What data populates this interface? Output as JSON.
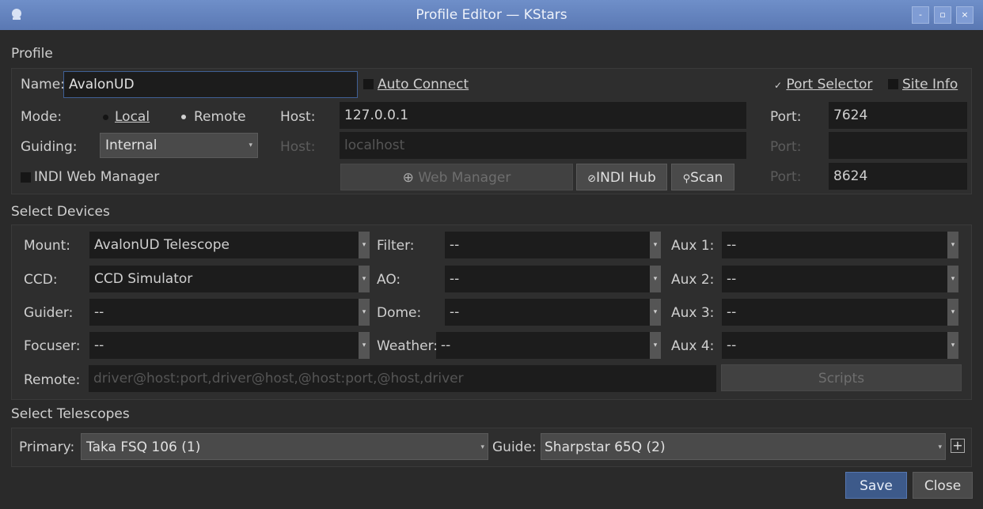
{
  "window": {
    "title": "Profile Editor — KStars",
    "controls": {
      "minimize": "-",
      "maximize": "▫",
      "close": "×"
    }
  },
  "profile": {
    "section_label": "Profile",
    "name_label": "Name:",
    "name_value": "AvalonUD",
    "auto_connect_label": "Auto Connect",
    "port_selector_label": "Port Selector",
    "port_selector_checked": true,
    "site_info_label": "Site Info",
    "mode_label": "Mode:",
    "mode_local": "Local",
    "mode_remote": "Remote",
    "mode_selected": "Remote",
    "host_label": "Host:",
    "host_value": "127.0.0.1",
    "port_label": "Port:",
    "port_value": "7624",
    "guiding_label": "Guiding:",
    "guiding_value": "Internal",
    "guide_host_label": "Host:",
    "guide_host_value": "localhost",
    "guide_port_label": "Port:",
    "guide_port_value": "",
    "indi_web_manager_label": "INDI Web Manager",
    "web_manager_button": "Web Manager",
    "indi_hub_button": "INDI Hub",
    "scan_button": "Scan",
    "web_port_label": "Port:",
    "web_port_value": "8624"
  },
  "devices": {
    "section_label": "Select Devices",
    "mount_label": "Mount:",
    "mount_value": "AvalonUD Telescope",
    "ccd_label": "CCD:",
    "ccd_value": "CCD Simulator",
    "guider_label": "Guider:",
    "guider_value": "--",
    "focuser_label": "Focuser:",
    "focuser_value": "--",
    "filter_label": "Filter:",
    "filter_value": "--",
    "ao_label": "AO:",
    "ao_value": "--",
    "dome_label": "Dome:",
    "dome_value": "--",
    "weather_label": "Weather:",
    "weather_value": "--",
    "aux1_label": "Aux 1:",
    "aux1_value": "--",
    "aux2_label": "Aux 2:",
    "aux2_value": "--",
    "aux3_label": "Aux 3:",
    "aux3_value": "--",
    "aux4_label": "Aux 4:",
    "aux4_value": "--",
    "remote_label": "Remote:",
    "remote_placeholder": "driver@host:port,driver@host,@host:port,@host,driver",
    "scripts_button": "Scripts"
  },
  "telescopes": {
    "section_label": "Select Telescopes",
    "primary_label": "Primary:",
    "primary_value": "Taka FSQ 106  (1)",
    "guide_label": "Guide:",
    "guide_value": "Sharpstar  65Q (2)",
    "add_button": "+"
  },
  "footer": {
    "save_button": "Save",
    "close_button": "Close"
  }
}
